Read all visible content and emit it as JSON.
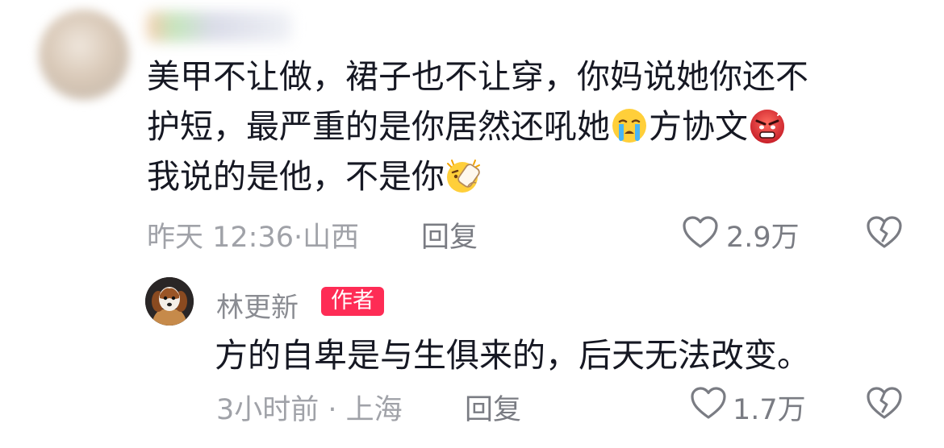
{
  "comment": {
    "text_line1": "美甲不让做，裙子也不让穿，你妈说她你还不",
    "text_line2_a": "护短，最严重的是你居然还吼她",
    "text_line2_b": "方协文",
    "text_line3": "我说的是他，不是你",
    "emojis": [
      "crying-emoji",
      "angry-emoji",
      "slap-emoji"
    ],
    "time": "昨天 12:36",
    "location": "山西",
    "reply_label": "回复",
    "likes": "2.9万"
  },
  "reply": {
    "author_name": "林更新",
    "author_badge": "作者",
    "text": "方的自卑是与生俱来的，后天无法改变。",
    "time": "3小时前",
    "location": "上海",
    "reply_label": "回复",
    "likes": "1.7万"
  },
  "colors": {
    "badge": "#fe2c55",
    "meta": "#a0a2a8",
    "text": "#161823"
  }
}
